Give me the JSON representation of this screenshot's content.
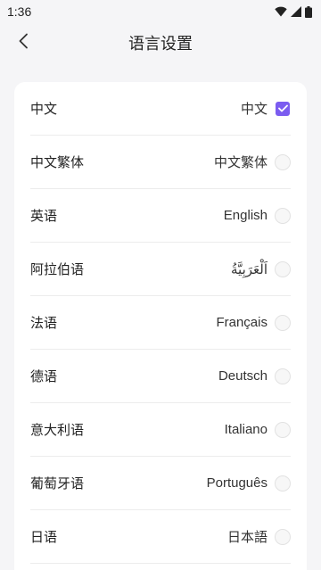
{
  "status": {
    "time": "1:36"
  },
  "header": {
    "title": "语言设置"
  },
  "accent": "#7b5cf0",
  "languages": [
    {
      "name": "中文",
      "native": "中文",
      "selected": true
    },
    {
      "name": "中文繁体",
      "native": "中文繁体",
      "selected": false
    },
    {
      "name": "英语",
      "native": "English",
      "selected": false
    },
    {
      "name": "阿拉伯语",
      "native": "اَلْعَرَبِيَّةُ",
      "selected": false
    },
    {
      "name": "法语",
      "native": "Français",
      "selected": false
    },
    {
      "name": "德语",
      "native": "Deutsch",
      "selected": false
    },
    {
      "name": "意大利语",
      "native": "Italiano",
      "selected": false
    },
    {
      "name": "葡萄牙语",
      "native": "Português",
      "selected": false
    },
    {
      "name": "日语",
      "native": "日本語",
      "selected": false
    }
  ]
}
